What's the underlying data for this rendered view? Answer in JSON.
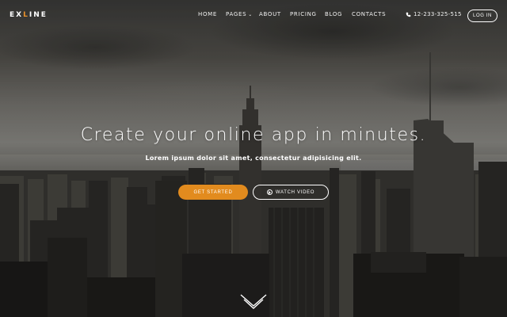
{
  "brand": {
    "logo_prefix": "EX",
    "logo_accent": "L",
    "logo_suffix": "INE"
  },
  "nav": {
    "items": [
      {
        "label": "HOME"
      },
      {
        "label": "PAGES"
      },
      {
        "label": "ABOUT"
      },
      {
        "label": "PRICING"
      },
      {
        "label": "BLOG"
      },
      {
        "label": "CONTACTS"
      }
    ],
    "phone": "12-233-325-515",
    "login_label": "LOG IN"
  },
  "hero": {
    "title": "Create your online app in minutes.",
    "subtitle": "Lorem ipsum dolor sit amet, consectetur adipisicing elit.",
    "primary_cta": "GET STARTED",
    "secondary_cta": "WATCH VIDEO"
  },
  "icons": {
    "phone": "phone-icon",
    "pages_dropdown": "chevron-down-icon",
    "video": "play-circle-icon",
    "scroll": "double-chevron-down-icon"
  },
  "colors": {
    "accent": "#e28b1e",
    "text": "#ffffff"
  }
}
